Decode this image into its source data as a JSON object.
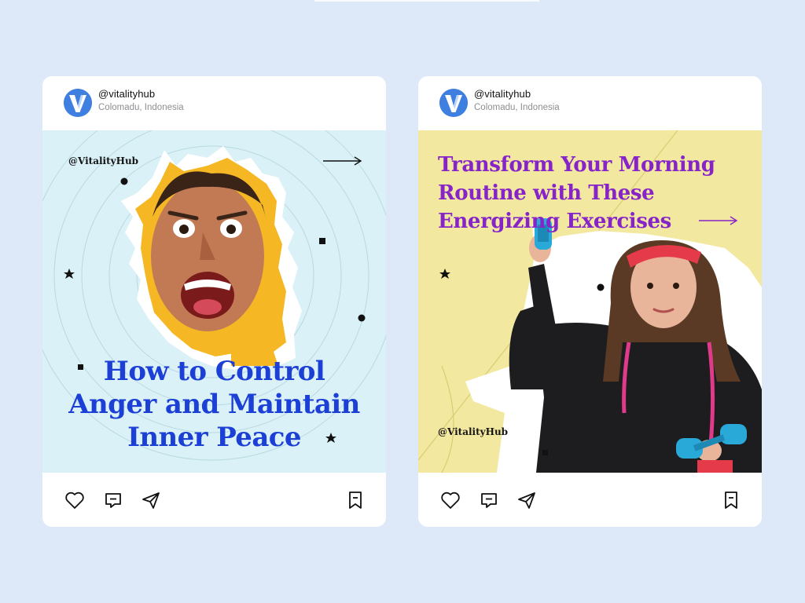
{
  "posts": [
    {
      "account": {
        "handle": "@vitalityhub",
        "location": "Colomadu, Indonesia",
        "avatar_letter": "V"
      },
      "media": {
        "watermark": "@VitalityHub",
        "headline_lines": [
          "How to Control",
          "Anger and Maintain",
          "Inner Peace"
        ],
        "headline_color": "#1c3fd6",
        "background_color": "#daf1f7"
      },
      "actions": {
        "like_icon": "heart-icon",
        "comment_icon": "comment-icon",
        "share_icon": "send-icon",
        "save_icon": "bookmark-icon"
      }
    },
    {
      "account": {
        "handle": "@vitalityhub",
        "location": "Colomadu, Indonesia",
        "avatar_letter": "V"
      },
      "media": {
        "watermark": "@VitalityHub",
        "headline_lines": [
          "Transform Your Morning",
          "Routine with These",
          "Energizing Exercises"
        ],
        "headline_color": "#8624c9",
        "background_color": "#f3e8a0"
      },
      "actions": {
        "like_icon": "heart-icon",
        "comment_icon": "comment-icon",
        "share_icon": "send-icon",
        "save_icon": "bookmark-icon"
      }
    }
  ],
  "colors": {
    "page_background": "#dde8f8",
    "card_background": "#ffffff",
    "brand_blue": "#3f7fe0"
  }
}
